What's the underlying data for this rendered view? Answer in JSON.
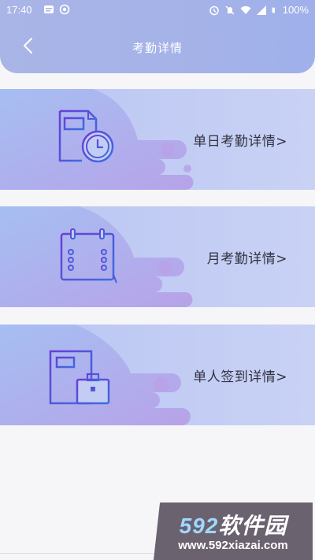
{
  "status_bar": {
    "time": "17:40",
    "battery": "100%"
  },
  "header": {
    "title": "考勤详情"
  },
  "cards": [
    {
      "label": "单日考勤详情>",
      "icon": "document-clock-icon"
    },
    {
      "label": "月考勤详情>",
      "icon": "calendar-icon"
    },
    {
      "label": "单人签到详情>",
      "icon": "document-briefcase-icon"
    }
  ],
  "watermark": {
    "logo_digits": "592",
    "logo_text": "软件园",
    "url": "www.592xiazai.com"
  },
  "colors": {
    "header": "#a6b3e8",
    "card_bg": "#c3cdf4",
    "icon_gradient_start": "#6a3dd6",
    "icon_gradient_end": "#3a6fe0"
  }
}
